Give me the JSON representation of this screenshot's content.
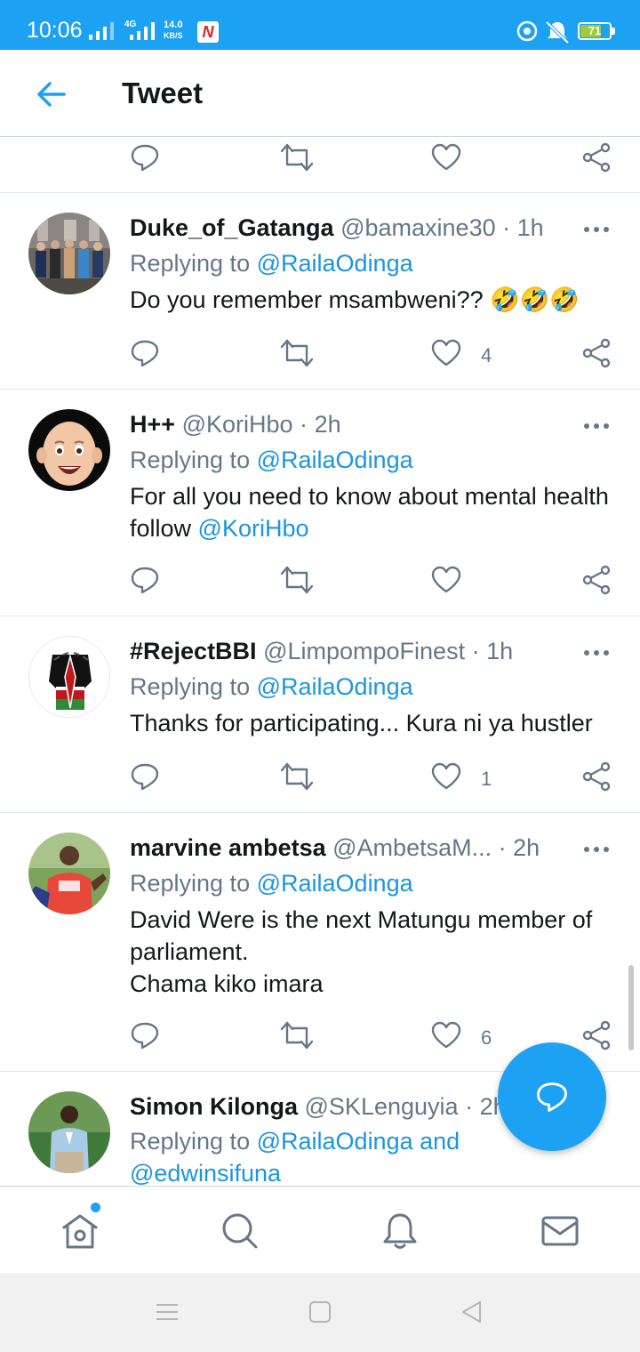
{
  "status_bar": {
    "time": "10:06",
    "network_type": "4G",
    "net_speed_value": "14.0",
    "net_speed_unit": "KB/S",
    "notification_badge": "N",
    "battery_level": "71"
  },
  "header": {
    "title": "Tweet"
  },
  "top_actions": {
    "reply_count": "",
    "retweet_count": "",
    "like_count": ""
  },
  "tweets": [
    {
      "name": "Duke_of_Gatanga",
      "handle": "@bamaxine30",
      "separator": "·",
      "time": "1h",
      "replying_prefix": "Replying to",
      "replying_to": "@RailaOdinga",
      "text": "Do you remember msambweni?? 🤣🤣🤣",
      "like_count": "4"
    },
    {
      "name": "H++",
      "handle": "@KoriHbo",
      "separator": "·",
      "time": "2h",
      "replying_prefix": "Replying to",
      "replying_to": "@RailaOdinga",
      "text": "For all you need to know about mental health follow",
      "text_mention": "@KoriHbo",
      "like_count": ""
    },
    {
      "name": "#RejectBBI",
      "handle": "@LimpompoFinest",
      "separator": "·",
      "time": "1h",
      "replying_prefix": "Replying to",
      "replying_to": "@RailaOdinga",
      "text": "Thanks for participating... Kura ni ya hustler",
      "like_count": "1"
    },
    {
      "name": "marvine ambetsa",
      "handle": "@AmbetsaM...",
      "separator": "·",
      "time": "2h",
      "replying_prefix": "Replying to",
      "replying_to": "@RailaOdinga",
      "text_line1": "David Were is the next Matungu member of parliament.",
      "text_line2": "Chama kiko imara",
      "like_count": "6"
    },
    {
      "name": "Simon Kilonga",
      "handle": "@SKLenguyia",
      "separator": "·",
      "time": "2h",
      "replying_prefix": "Replying to",
      "replying_to": "@RailaOdinga and",
      "replying_to_2": "@edwinsifuna"
    }
  ],
  "icons": {
    "reply": "reply-icon",
    "retweet": "retweet-icon",
    "like": "heart-icon",
    "share": "share-icon",
    "more": "more-icon",
    "compose": "compose-reply-icon",
    "home": "home-icon",
    "search": "search-icon",
    "notifications": "bell-icon",
    "messages": "mail-icon"
  },
  "colors": {
    "brand": "#1da1f2",
    "link": "#1b95e0",
    "secondary_text": "#657786",
    "divider": "#e1e8ed"
  }
}
